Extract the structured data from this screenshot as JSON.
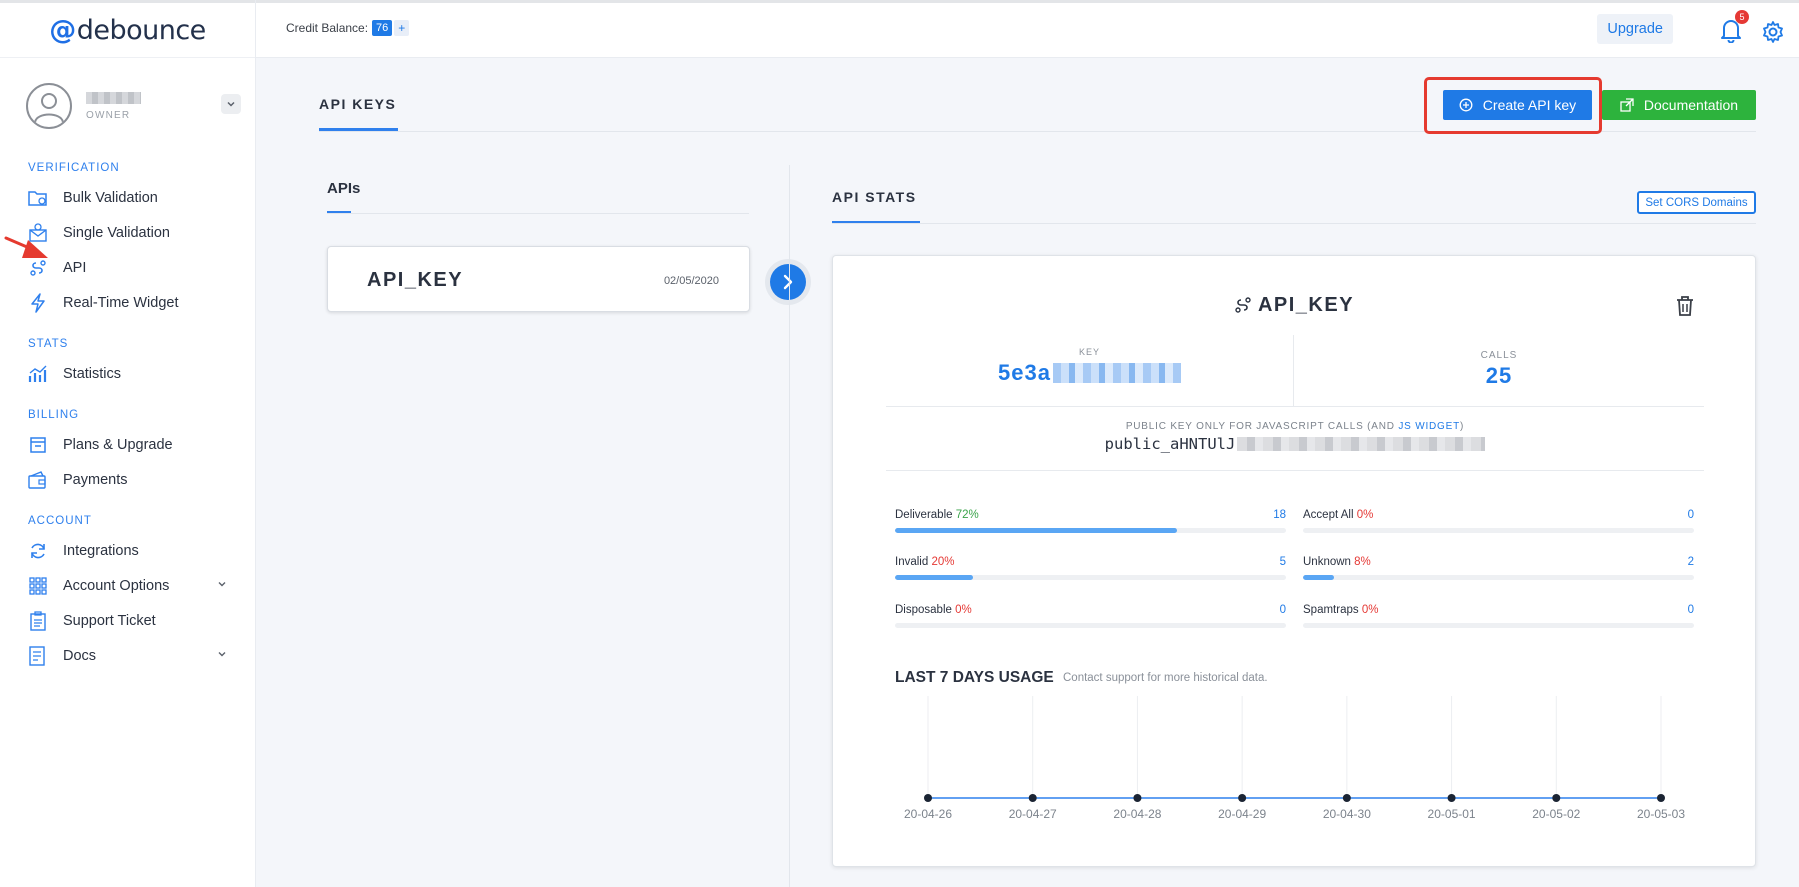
{
  "brand": {
    "prefix": "@",
    "name": "debounce"
  },
  "user": {
    "role": "OWNER"
  },
  "topbar": {
    "credit_label": "Credit Balance:",
    "credit_value": "76",
    "credit_plus": "+",
    "upgrade_label": "Upgrade",
    "notification_count": "5"
  },
  "sidebar": {
    "sections": [
      {
        "title": "VERIFICATION",
        "items": [
          {
            "label": "Bulk Validation",
            "icon": "bulk-folder-icon"
          },
          {
            "label": "Single Validation",
            "icon": "single-envelope-icon"
          },
          {
            "label": "API",
            "icon": "api-link-icon"
          },
          {
            "label": "Real-Time Widget",
            "icon": "lightning-icon"
          }
        ]
      },
      {
        "title": "STATS",
        "items": [
          {
            "label": "Statistics",
            "icon": "bar-chart-icon"
          }
        ]
      },
      {
        "title": "BILLING",
        "items": [
          {
            "label": "Plans & Upgrade",
            "icon": "box-icon"
          },
          {
            "label": "Payments",
            "icon": "wallet-icon"
          }
        ]
      },
      {
        "title": "ACCOUNT",
        "items": [
          {
            "label": "Integrations",
            "icon": "refresh-icon"
          },
          {
            "label": "Account Options",
            "icon": "grid-icon"
          },
          {
            "label": "Support Ticket",
            "icon": "clipboard-icon"
          },
          {
            "label": "Docs",
            "icon": "document-icon"
          }
        ]
      }
    ]
  },
  "main": {
    "page_tab": "API KEYS",
    "create_button": "Create API key",
    "docs_button": "Documentation",
    "apis_title": "APIs",
    "api_card": {
      "name": "API_KEY",
      "date": "02/05/2020"
    },
    "stats_title": "API STATS",
    "cors_button": "Set CORS Domains"
  },
  "stats_card": {
    "title": "API_KEY",
    "key_label": "KEY",
    "key_value_visible": "5e3a",
    "calls_label": "CALLS",
    "calls_value": "25",
    "public_label_prefix": "PUBLIC KEY ONLY FOR JAVASCRIPT CALLS (AND ",
    "public_label_link": "JS WIDGET",
    "public_label_suffix": ")",
    "public_value_visible": "public_aHNTUlJ",
    "metrics": [
      {
        "label": "Deliverable",
        "pct": "72%",
        "count": "18",
        "fraction": 0.72,
        "tone": "green"
      },
      {
        "label": "Accept All",
        "pct": "0%",
        "count": "0",
        "fraction": 0.0,
        "tone": "red"
      },
      {
        "label": "Invalid",
        "pct": "20%",
        "count": "5",
        "fraction": 0.2,
        "tone": "red"
      },
      {
        "label": "Unknown",
        "pct": "8%",
        "count": "2",
        "fraction": 0.08,
        "tone": "red"
      },
      {
        "label": "Disposable",
        "pct": "0%",
        "count": "0",
        "fraction": 0.0,
        "tone": "red"
      },
      {
        "label": "Spamtraps",
        "pct": "0%",
        "count": "0",
        "fraction": 0.0,
        "tone": "red"
      }
    ],
    "usage_title": "LAST 7 DAYS USAGE",
    "usage_subtitle": "Contact support for more historical data."
  },
  "chart_data": {
    "type": "line",
    "title": "LAST 7 DAYS USAGE",
    "categories": [
      "20-04-26",
      "20-04-27",
      "20-04-28",
      "20-04-29",
      "20-04-30",
      "20-05-01",
      "20-05-02",
      "20-05-03"
    ],
    "values": [
      0,
      0,
      0,
      0,
      0,
      0,
      0,
      0
    ],
    "grid": "vertical",
    "colors": {
      "line": "#2f80ed",
      "point": "#1b2433"
    }
  },
  "colors": {
    "accent": "#1f7ae6",
    "success": "#2db33d",
    "danger": "#e53935",
    "highlight": "#e53a2f"
  }
}
